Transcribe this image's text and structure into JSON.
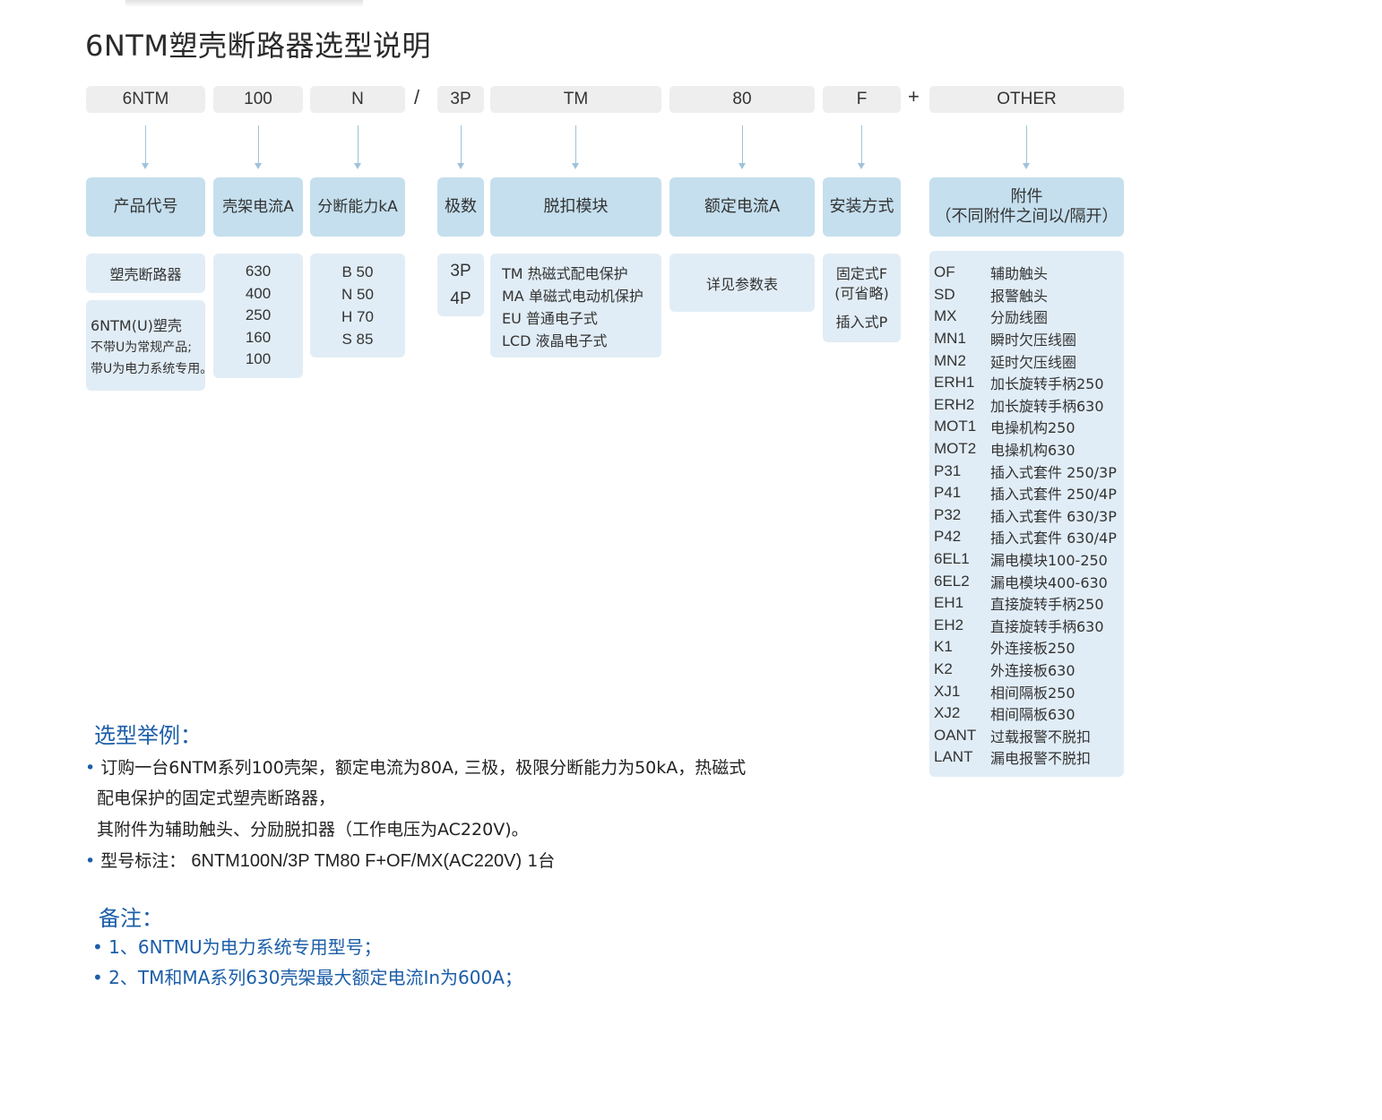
{
  "title": "6NTM塑壳断路器选型说明",
  "code": {
    "brand": "6NTM",
    "frame": "100",
    "breaking": "N",
    "slash": "/",
    "poles": "3P",
    "trip": "TM",
    "current": "80",
    "mount": "F",
    "plus": "+",
    "other": "OTHER"
  },
  "headers": {
    "product": "产品代号",
    "frame": "壳架电流A",
    "breaking": "分断能力kA",
    "poles": "极数",
    "trip": "脱扣模块",
    "current": "额定电流A",
    "mount": "安装方式",
    "acc_line1": "附件",
    "acc_line2": "（不同附件之间以/隔开）"
  },
  "product": {
    "name": "塑壳断路器",
    "note_line1": "6NTM(U)塑壳",
    "note_line2": "不带U为常规产品;",
    "note_line3": "带U为电力系统专用。"
  },
  "frame_values": [
    "630",
    "400",
    "250",
    "160",
    "100"
  ],
  "breaking_values": [
    "B 50",
    "N 50",
    "H 70",
    "S 85"
  ],
  "pole_values": [
    "3P",
    "4P"
  ],
  "trip_values": [
    "TM 热磁式配电保护",
    "MA 单磁式电动机保护",
    "EU 普通电子式",
    "LCD 液晶电子式"
  ],
  "current_text": "详见参数表",
  "mount": {
    "fixed": "固定式F",
    "omit": "(可省略)",
    "plugin": "插入式P"
  },
  "accessories": [
    {
      "code": "OF",
      "desc": "辅助触头"
    },
    {
      "code": "SD",
      "desc": "报警触头"
    },
    {
      "code": "MX",
      "desc": "分励线圈"
    },
    {
      "code": "MN1",
      "desc": "瞬时欠压线圈"
    },
    {
      "code": "MN2",
      "desc": "延时欠压线圈"
    },
    {
      "code": "ERH1",
      "desc": "加长旋转手柄250"
    },
    {
      "code": "ERH2",
      "desc": "加长旋转手柄630"
    },
    {
      "code": "MOT1",
      "desc": "电操机构250"
    },
    {
      "code": "MOT2",
      "desc": "电操机构630"
    },
    {
      "code": "P31",
      "desc": "插入式套件 250/3P"
    },
    {
      "code": "P41",
      "desc": "插入式套件 250/4P"
    },
    {
      "code": "P32",
      "desc": "插入式套件 630/3P"
    },
    {
      "code": "P42",
      "desc": "插入式套件 630/4P"
    },
    {
      "code": "6EL1",
      "desc": "漏电模块100-250"
    },
    {
      "code": "6EL2",
      "desc": "漏电模块400-630"
    },
    {
      "code": "EH1",
      "desc": "直接旋转手柄250"
    },
    {
      "code": "EH2",
      "desc": "直接旋转手柄630"
    },
    {
      "code": "K1",
      "desc": "外连接板250"
    },
    {
      "code": "K2",
      "desc": "外连接板630"
    },
    {
      "code": "XJ1",
      "desc": "相间隔板250"
    },
    {
      "code": "XJ2",
      "desc": "相间隔板630"
    },
    {
      "code": "OANT",
      "desc": "过载报警不脱扣"
    },
    {
      "code": "LANT",
      "desc": "漏电报警不脱扣"
    }
  ],
  "example": {
    "heading": "选型举例：",
    "line1": "订购一台6NTM系列100壳架，额定电流为80A, 三极，极限分断能力为50kA，热磁式",
    "line2": "配电保护的固定式塑壳断路器，",
    "line3": "其附件为辅助触头、分励脱扣器（工作电压为AC220V)。",
    "model_label": "型号标注：",
    "model_value": "6NTM100N/3P TM80 F+OF/MX(AC220V)",
    "model_qty": "1台"
  },
  "notes": {
    "heading": "备注：",
    "item1": "1、6NTMU为电力系统专用型号；",
    "item2": "2、TM和MA系列630壳架最大额定电流In为600A；"
  },
  "colors": {
    "code_box": "#eeeeee",
    "header_box": "#c5dfee",
    "info_box": "#e1edf6",
    "arrow": "#9fc3dc",
    "accent_blue": "#1c5ea8"
  }
}
